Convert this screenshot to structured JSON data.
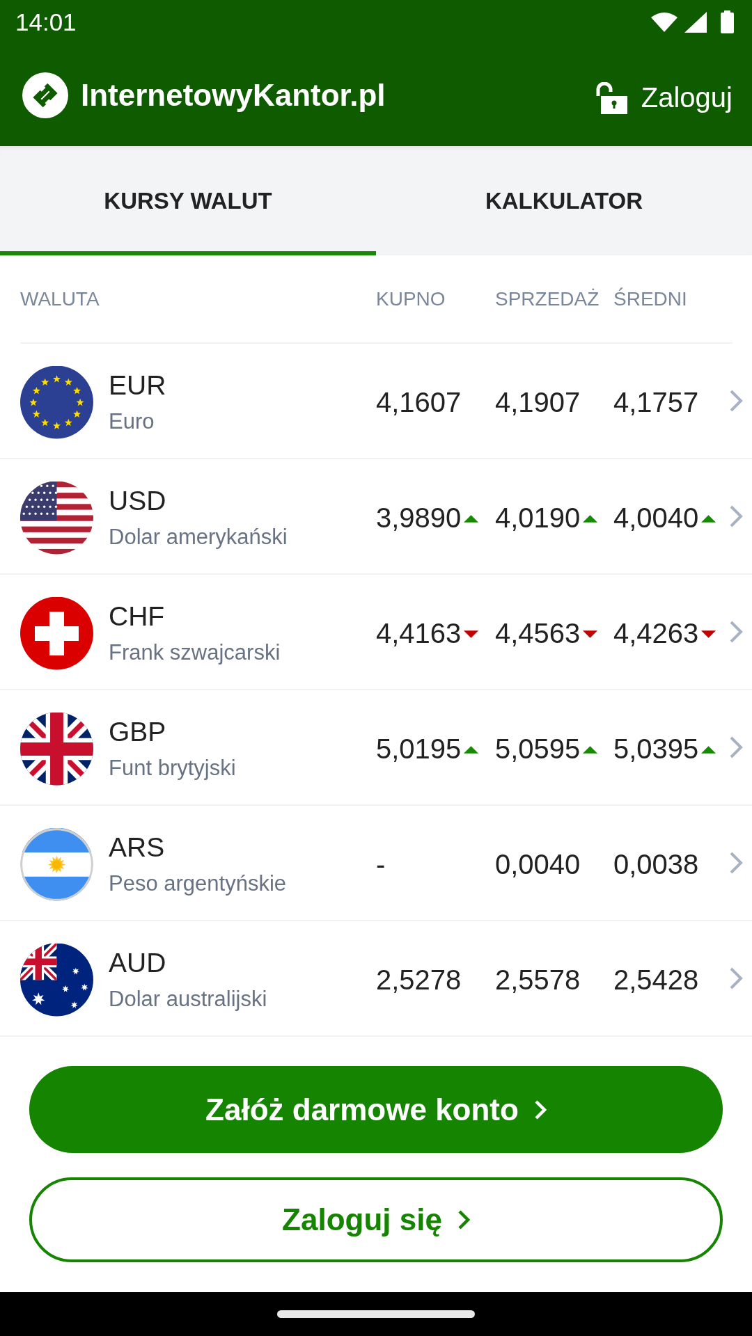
{
  "status_bar": {
    "time": "14:01"
  },
  "header": {
    "logo_text": "InternetowyKantor.pl",
    "login": "Zaloguj"
  },
  "tabs": [
    {
      "label": "KURSY WALUT",
      "selected": true
    },
    {
      "label": "KALKULATOR",
      "selected": false
    }
  ],
  "table": {
    "columns": [
      "WALUTA",
      "KUPNO",
      "SPRZEDAŻ",
      "ŚREDNI"
    ],
    "rows": [
      {
        "kind": "eu",
        "code": "EUR",
        "name": "Euro",
        "rates": [
          {
            "value": "4,1607",
            "rising": false,
            "falling": false
          },
          {
            "value": "4,1907",
            "rising": false,
            "falling": false
          },
          {
            "value": "4,1757",
            "rising": false,
            "falling": false
          }
        ]
      },
      {
        "kind": "us",
        "code": "USD",
        "name": "Dolar amerykański",
        "rates": [
          {
            "value": "3,9890",
            "rising": true,
            "falling": false
          },
          {
            "value": "4,0190",
            "rising": true,
            "falling": false
          },
          {
            "value": "4,0040",
            "rising": true,
            "falling": false
          }
        ]
      },
      {
        "kind": "ch",
        "code": "CHF",
        "name": "Frank szwajcarski",
        "rates": [
          {
            "value": "4,4163",
            "rising": false,
            "falling": true
          },
          {
            "value": "4,4563",
            "rising": false,
            "falling": true
          },
          {
            "value": "4,4263",
            "rising": false,
            "falling": true
          }
        ]
      },
      {
        "kind": "gb",
        "code": "GBP",
        "name": "Funt brytyjski",
        "rates": [
          {
            "value": "5,0195",
            "rising": true,
            "falling": false
          },
          {
            "value": "5,0595",
            "rising": true,
            "falling": false
          },
          {
            "value": "5,0395",
            "rising": true,
            "falling": false
          }
        ]
      },
      {
        "kind": "ar",
        "code": "ARS",
        "name": "Peso argentyńskie",
        "rates": [
          {
            "value": "-",
            "rising": false,
            "falling": false
          },
          {
            "value": "0,0040",
            "rising": false,
            "falling": false
          },
          {
            "value": "0,0038",
            "rising": false,
            "falling": false
          }
        ]
      },
      {
        "kind": "au",
        "code": "AUD",
        "name": "Dolar australijski",
        "rates": [
          {
            "value": "2,5278",
            "rising": false,
            "falling": false
          },
          {
            "value": "2,5578",
            "rising": false,
            "falling": false
          },
          {
            "value": "2,5428",
            "rising": false,
            "falling": false
          }
        ]
      }
    ]
  },
  "buttons": [
    {
      "label": "Załóż darmowe konto",
      "kind": "filled"
    },
    {
      "label": "Zaloguj się",
      "kind": "outline"
    }
  ]
}
